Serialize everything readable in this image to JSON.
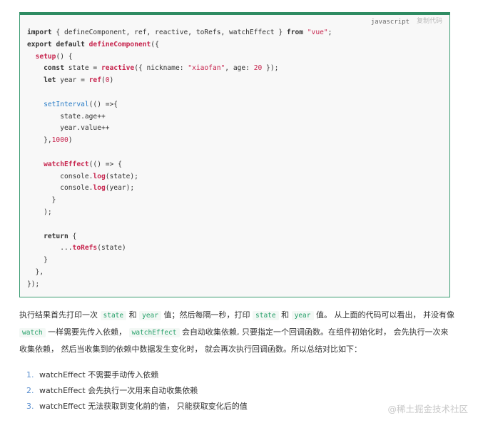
{
  "code_block": {
    "language": "javascript",
    "copy_label": "复制代码",
    "tokens": {
      "l1_a": "import",
      "l1_b": " { defineComponent, ref, reactive, toRefs, watchEffect } ",
      "l1_c": "from",
      "l1_d": " ",
      "l1_e": "\"vue\"",
      "l1_f": ";",
      "l2_a": "export",
      "l2_b": " ",
      "l2_c": "default",
      "l2_d": " ",
      "l2_e": "defineComponent",
      "l2_f": "({",
      "l3_a": "  ",
      "l3_b": "setup",
      "l3_c": "() {",
      "l4_a": "    ",
      "l4_b": "const",
      "l4_c": " state = ",
      "l4_d": "reactive",
      "l4_e": "({ nickname: ",
      "l4_f": "\"xiaofan\"",
      "l4_g": ", age: ",
      "l4_h": "20",
      "l4_i": " });",
      "l5_a": "    ",
      "l5_b": "let",
      "l5_c": " year = ",
      "l5_d": "ref",
      "l5_e": "(",
      "l5_f": "0",
      "l5_g": ")",
      "l7_a": "    ",
      "l7_b": "setInterval",
      "l7_c": "(() =>{",
      "l8": "        state.age++",
      "l9": "        year.value++",
      "l10_a": "    },",
      "l10_b": "1000",
      "l10_c": ")",
      "l12_a": "    ",
      "l12_b": "watchEffect",
      "l12_c": "(() => {",
      "l13_a": "        console.",
      "l13_b": "log",
      "l13_c": "(state);",
      "l14_a": "        console.",
      "l14_b": "log",
      "l14_c": "(year);",
      "l15": "      }",
      "l16": "    );",
      "l18_a": "    ",
      "l18_b": "return",
      "l18_c": " {",
      "l19_a": "        ...",
      "l19_b": "toRefs",
      "l19_c": "(state)",
      "l20": "    }",
      "l21": "  },",
      "l22": "});"
    }
  },
  "paragraph": {
    "s1": "执行结果首先打印一次 ",
    "c1": "state",
    "s2": " 和 ",
    "c2": "year",
    "s3": " 值；然后每隔一秒，打印 ",
    "c3": "state",
    "s4": " 和 ",
    "c4": "year",
    "s5": " 值。 从上面的代码可以看出， 并没有像 ",
    "c5": "watch",
    "s6": " 一样需要先传入依赖， ",
    "c6": "watchEffect",
    "s7": " 会自动收集依赖, 只要指定一个回调函数。在组件初始化时， 会先执行一次来收集依赖， 然后当收集到的依赖中数据发生变化时， 就会再次执行回调函数。所以总结对比如下："
  },
  "list": [
    {
      "num": "1.",
      "text": "watchEffect 不需要手动传入依赖"
    },
    {
      "num": "2.",
      "text": "watchEffect 会先执行一次用来自动收集依赖"
    },
    {
      "num": "3.",
      "text": "watchEffect 无法获取到变化前的值， 只能获取变化后的值"
    }
  ],
  "watermark": "@稀土掘金技术社区",
  "colors": {
    "accent_border": "#2e8b62",
    "inline_code": "#27a16a",
    "string": "#c7254e",
    "builtin": "#2a7dc7"
  }
}
